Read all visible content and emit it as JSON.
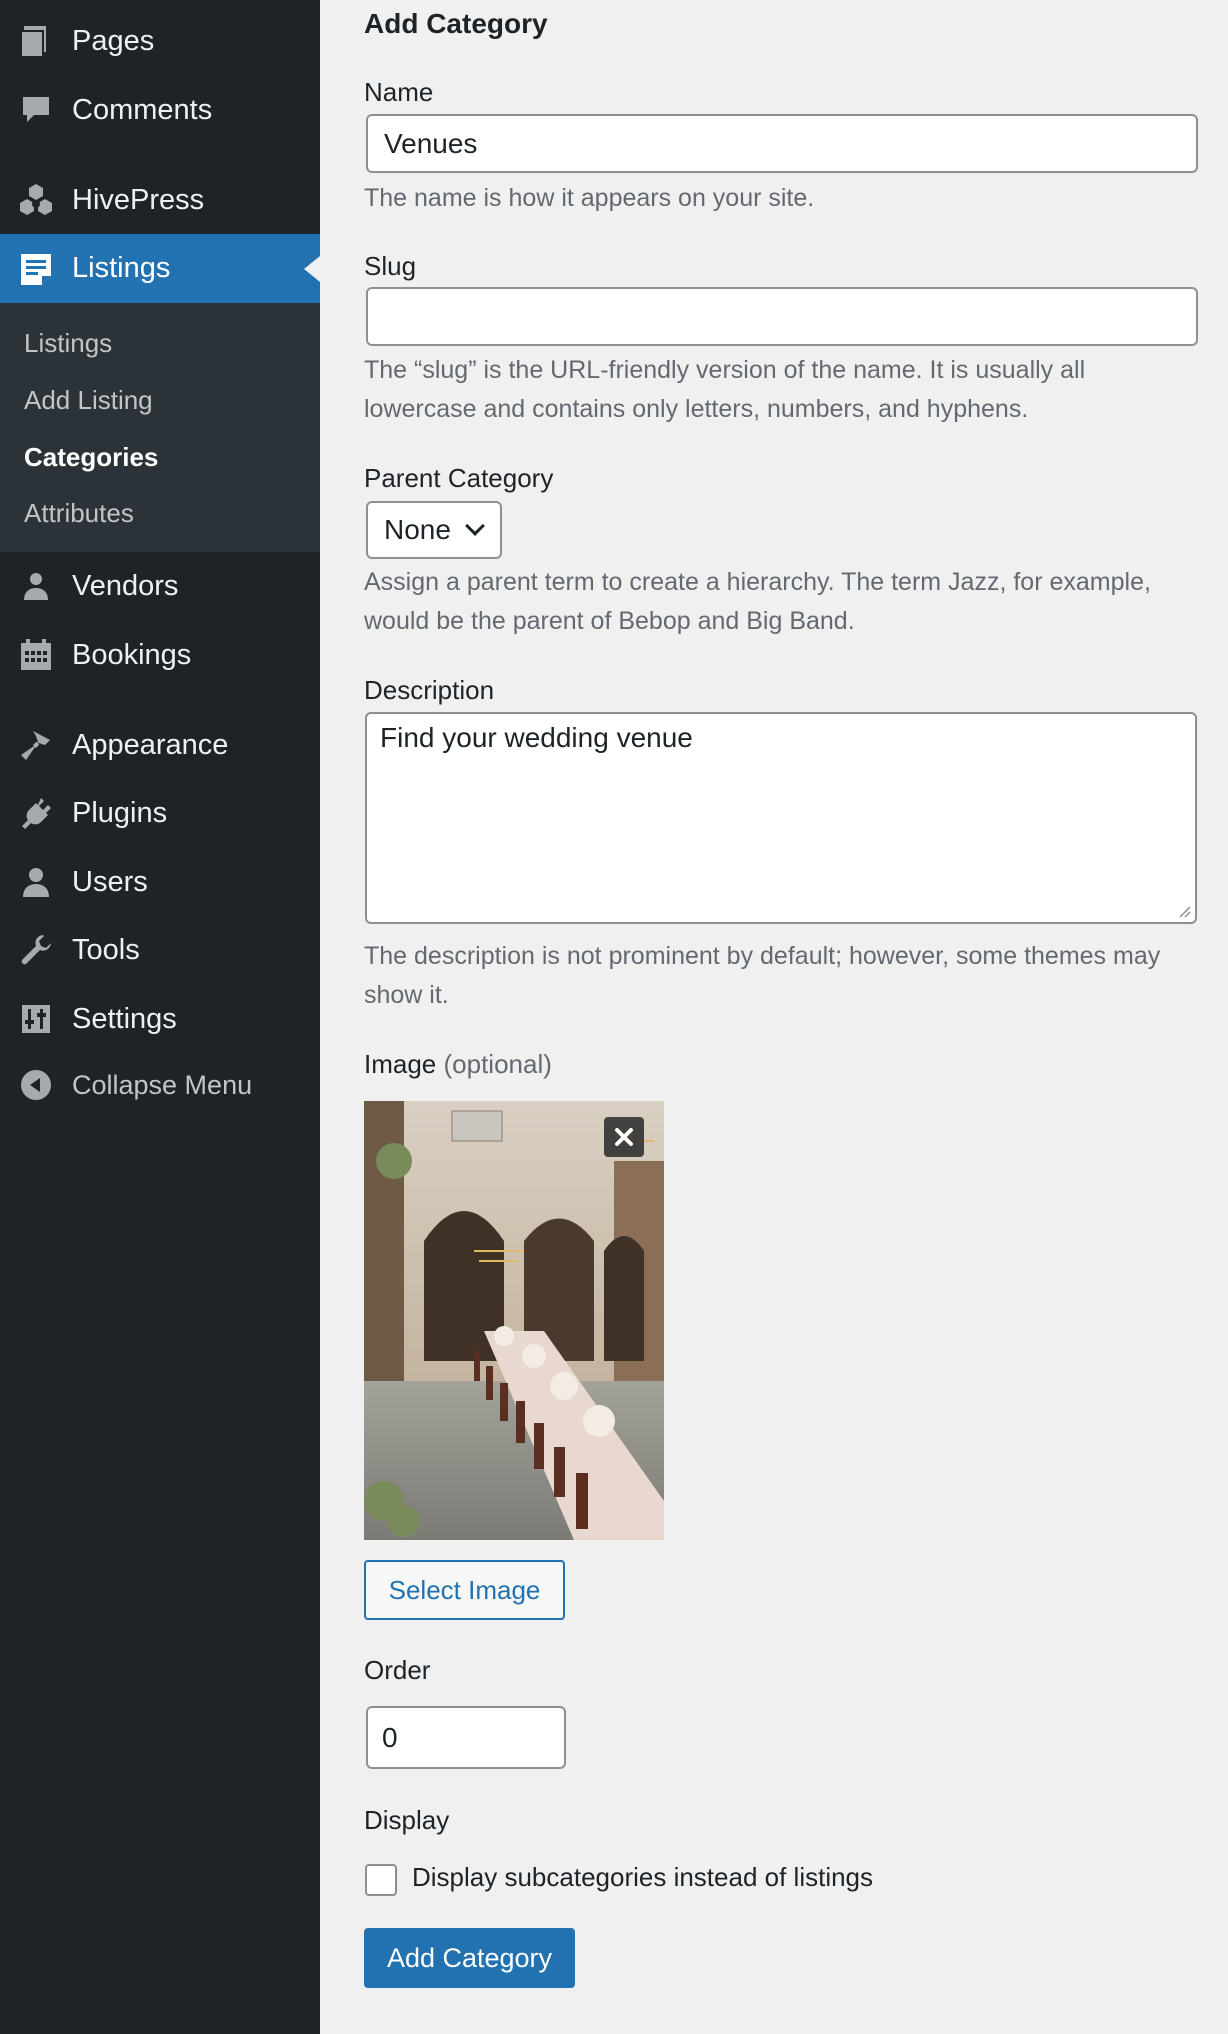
{
  "sidebar": {
    "items": [
      {
        "label": "Pages",
        "icon": "pages-icon"
      },
      {
        "label": "Comments",
        "icon": "comments-icon"
      },
      {
        "label": "HivePress",
        "icon": "hivepress-icon"
      },
      {
        "label": "Listings",
        "icon": "listings-icon"
      },
      {
        "label": "Vendors",
        "icon": "vendors-icon"
      },
      {
        "label": "Bookings",
        "icon": "calendar-icon"
      },
      {
        "label": "Appearance",
        "icon": "paintbrush-icon"
      },
      {
        "label": "Plugins",
        "icon": "plugin-icon"
      },
      {
        "label": "Users",
        "icon": "user-icon"
      },
      {
        "label": "Tools",
        "icon": "wrench-icon"
      },
      {
        "label": "Settings",
        "icon": "settings-icon"
      }
    ],
    "submenu": [
      "Listings",
      "Add Listing",
      "Categories",
      "Attributes"
    ],
    "collapse_label": "Collapse Menu"
  },
  "form": {
    "title": "Add Category",
    "name": {
      "label": "Name",
      "value": "Venues",
      "help": "The name is how it appears on your site."
    },
    "slug": {
      "label": "Slug",
      "value": "",
      "help": "The “slug” is the URL-friendly version of the name. It is usually all lowercase and contains only letters, numbers, and hyphens."
    },
    "parent": {
      "label": "Parent Category",
      "selected": "None",
      "help": "Assign a parent term to create a hierarchy. The term Jazz, for example, would be the parent of Bebop and Big Band."
    },
    "description": {
      "label": "Description",
      "value": "Find your wedding venue",
      "help": "The description is not prominent by default; however, some themes may show it."
    },
    "image": {
      "label": "Image",
      "optional": "(optional)",
      "select_label": "Select Image"
    },
    "order": {
      "label": "Order",
      "value": "0"
    },
    "display": {
      "label": "Display",
      "checkbox_label": "Display subcategories instead of listings",
      "checked": false
    },
    "submit_label": "Add Category"
  },
  "colors": {
    "sidebar_bg": "#1d2327",
    "submenu_bg": "#2c3338",
    "accent": "#2271b1",
    "page_bg": "#f0f0f1"
  }
}
